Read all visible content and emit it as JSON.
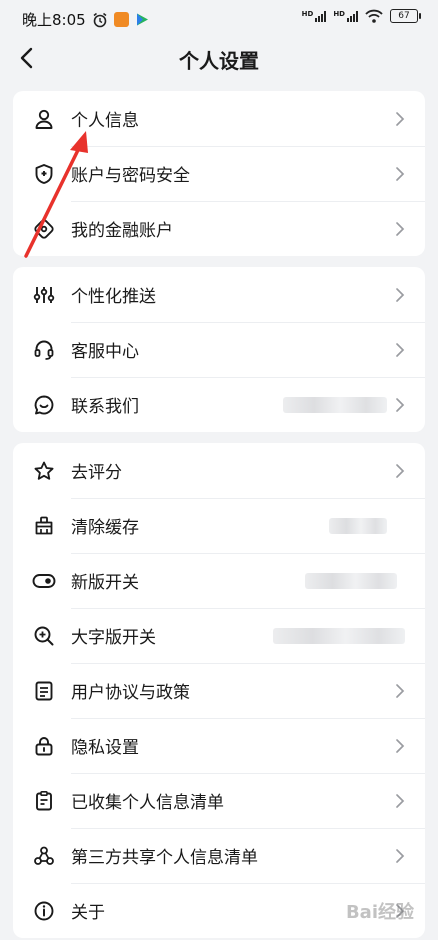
{
  "status_bar": {
    "time": "晚上8:05",
    "battery": "67",
    "signal_label": "HD"
  },
  "header": {
    "title": "个人设置",
    "back_icon": "chevron-left-icon"
  },
  "groups": [
    {
      "items": [
        {
          "label": "个人信息",
          "icon": "person-icon"
        },
        {
          "label": "账户与密码安全",
          "icon": "shield-icon"
        },
        {
          "label": "我的金融账户",
          "icon": "diamond-icon"
        }
      ]
    },
    {
      "items": [
        {
          "label": "个性化推送",
          "icon": "sliders-icon"
        },
        {
          "label": "客服中心",
          "icon": "headset-icon"
        },
        {
          "label": "联系我们",
          "icon": "chat-icon"
        }
      ]
    },
    {
      "items": [
        {
          "label": "去评分",
          "icon": "star-icon"
        },
        {
          "label": "清除缓存",
          "icon": "broom-icon"
        },
        {
          "label": "新版开关",
          "icon": "toggle-icon"
        },
        {
          "label": "大字版开关",
          "icon": "zoom-in-icon"
        },
        {
          "label": "用户协议与政策",
          "icon": "document-icon"
        },
        {
          "label": "隐私设置",
          "icon": "lock-icon"
        },
        {
          "label": "已收集个人信息清单",
          "icon": "clipboard-icon"
        },
        {
          "label": "第三方共享个人信息清单",
          "icon": "share-icon"
        },
        {
          "label": "关于",
          "icon": "info-icon"
        }
      ]
    }
  ],
  "watermark": "Bai经验",
  "colors": {
    "background": "#f2f3f5",
    "card": "#ffffff",
    "annotation_arrow": "#e8322c"
  }
}
